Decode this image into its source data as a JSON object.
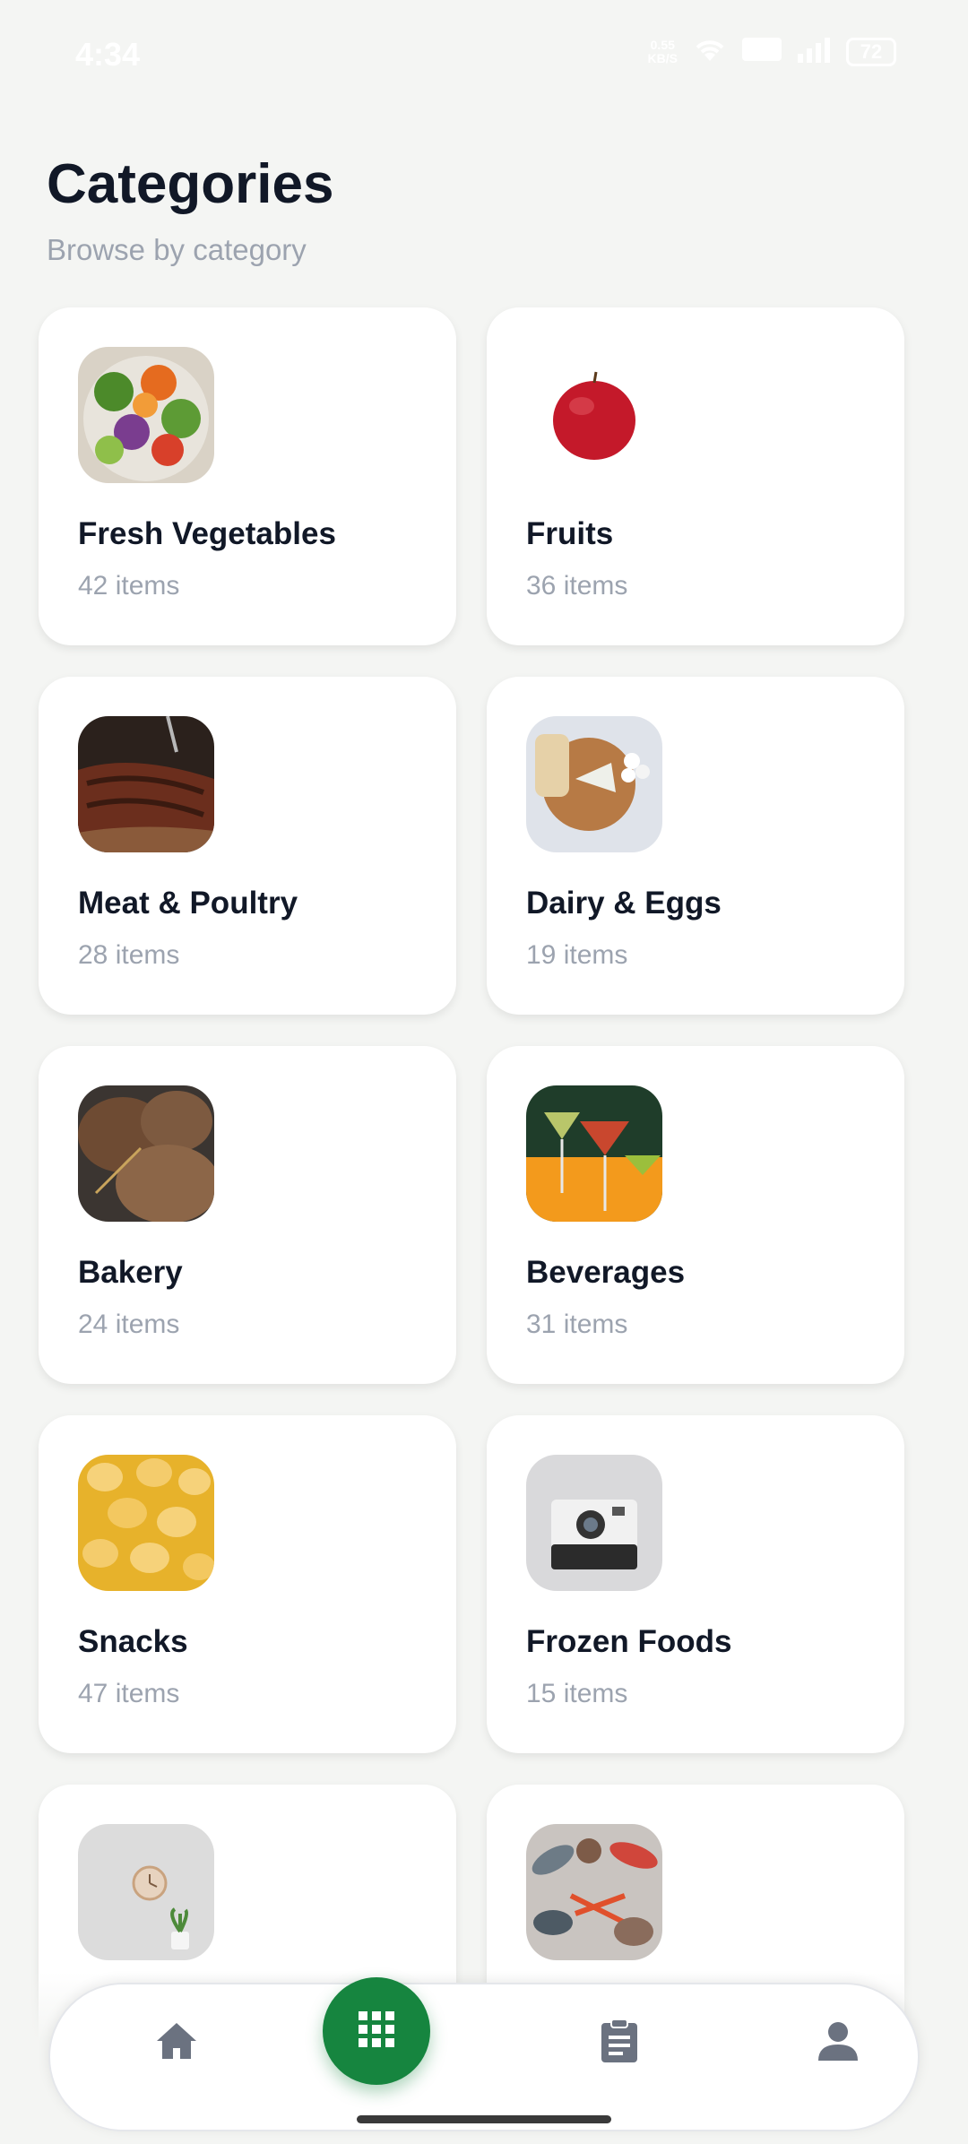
{
  "status_bar": {
    "time": "4:34",
    "net_speed": "0.55",
    "net_unit": "KB/S",
    "battery": "72"
  },
  "header": {
    "title": "Categories",
    "subtitle": "Browse by category"
  },
  "categories": [
    {
      "name": "Fresh Vegetables",
      "count": "42 items",
      "image": "salad-bowl-image"
    },
    {
      "name": "Fruits",
      "count": "36 items",
      "image": "red-apple-image"
    },
    {
      "name": "Meat & Poultry",
      "count": "28 items",
      "image": "grilled-steak-image"
    },
    {
      "name": "Dairy & Eggs",
      "count": "19 items",
      "image": "cheese-board-image"
    },
    {
      "name": "Bakery",
      "count": "24 items",
      "image": "bread-loaves-image"
    },
    {
      "name": "Beverages",
      "count": "31 items",
      "image": "cocktail-glasses-image"
    },
    {
      "name": "Snacks",
      "count": "47 items",
      "image": "potato-chips-image"
    },
    {
      "name": "Frozen Foods",
      "count": "15 items",
      "image": "instant-camera-image"
    },
    {
      "name": "",
      "count": "",
      "image": "wall-clock-plant-image"
    },
    {
      "name": "",
      "count": "",
      "image": "seafood-image"
    }
  ],
  "bottom_nav": {
    "items": [
      "home-icon",
      "categories-grid-icon",
      "orders-clipboard-icon",
      "profile-icon"
    ],
    "active": "categories-grid-icon",
    "accent": "#16853f",
    "inactive_color": "#6b7280"
  }
}
